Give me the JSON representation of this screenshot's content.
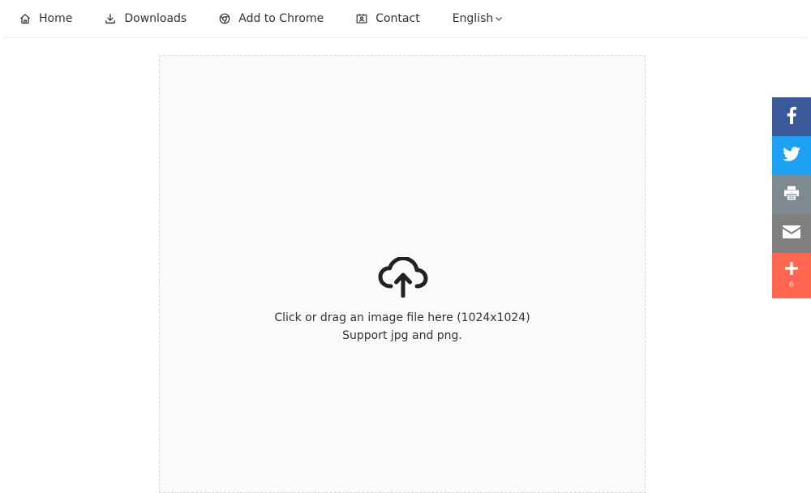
{
  "nav": {
    "items": [
      {
        "label": "Home",
        "icon": "home-icon"
      },
      {
        "label": "Downloads",
        "icon": "download-icon"
      },
      {
        "label": "Add to Chrome",
        "icon": "chrome-icon"
      },
      {
        "label": "Contact",
        "icon": "contact-card-icon"
      }
    ],
    "language": {
      "label": "English",
      "icon": "chevron-down-icon"
    }
  },
  "upload": {
    "icon": "cloud-upload-icon",
    "line1": "Click or drag an image file here (1024x1024)",
    "line2": "Support jpg and png."
  },
  "share": {
    "buttons": [
      {
        "network": "facebook",
        "icon": "facebook-icon",
        "color": "#3b5998"
      },
      {
        "network": "twitter",
        "icon": "twitter-icon",
        "color": "#1da1f2"
      },
      {
        "network": "print",
        "icon": "printer-icon",
        "color": "#7d8a90"
      },
      {
        "network": "email",
        "icon": "envelope-icon",
        "color": "#7f7f7f"
      },
      {
        "network": "more",
        "icon": "plus-icon",
        "color": "#ff6550"
      }
    ],
    "count": "6"
  },
  "colors": {
    "border": "#eeeeee",
    "dropzone_bg": "#fafafa",
    "text": "#333333"
  }
}
